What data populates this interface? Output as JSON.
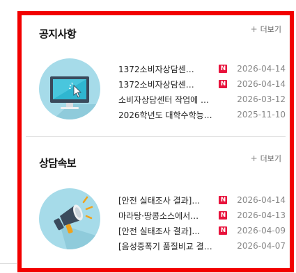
{
  "notice": {
    "title": "공지사항",
    "more_label": "더보기",
    "items": [
      {
        "title": "1372소비자상담센…",
        "is_new": true,
        "date": "2026-04-14"
      },
      {
        "title": "1372소비자상담센…",
        "is_new": true,
        "date": "2026-04-14"
      },
      {
        "title": "소비자상담센터 작업에 따…",
        "is_new": false,
        "date": "2026-03-12"
      },
      {
        "title": "2026학년도 대학수학능…",
        "is_new": false,
        "date": "2025-11-10"
      }
    ]
  },
  "consult": {
    "title": "상담속보",
    "more_label": "더보기",
    "items": [
      {
        "title": "[안전 실태조사 결과]…",
        "is_new": true,
        "date": "2026-04-14"
      },
      {
        "title": "마라탕·땅콩소스에서…",
        "is_new": true,
        "date": "2026-04-13"
      },
      {
        "title": "[안전 실태조사 결과]…",
        "is_new": true,
        "date": "2026-04-09"
      },
      {
        "title": "[음성증폭기 품질비교 결…",
        "is_new": false,
        "date": "2026-04-07"
      }
    ]
  },
  "badge_label": "N",
  "colors": {
    "highlight_border": "#f20000",
    "new_badge": "#e8133c",
    "icon_bg": "#a6dbe9"
  },
  "icons": [
    "monitor-cursor-icon",
    "megaphone-icon",
    "plus-icon"
  ]
}
